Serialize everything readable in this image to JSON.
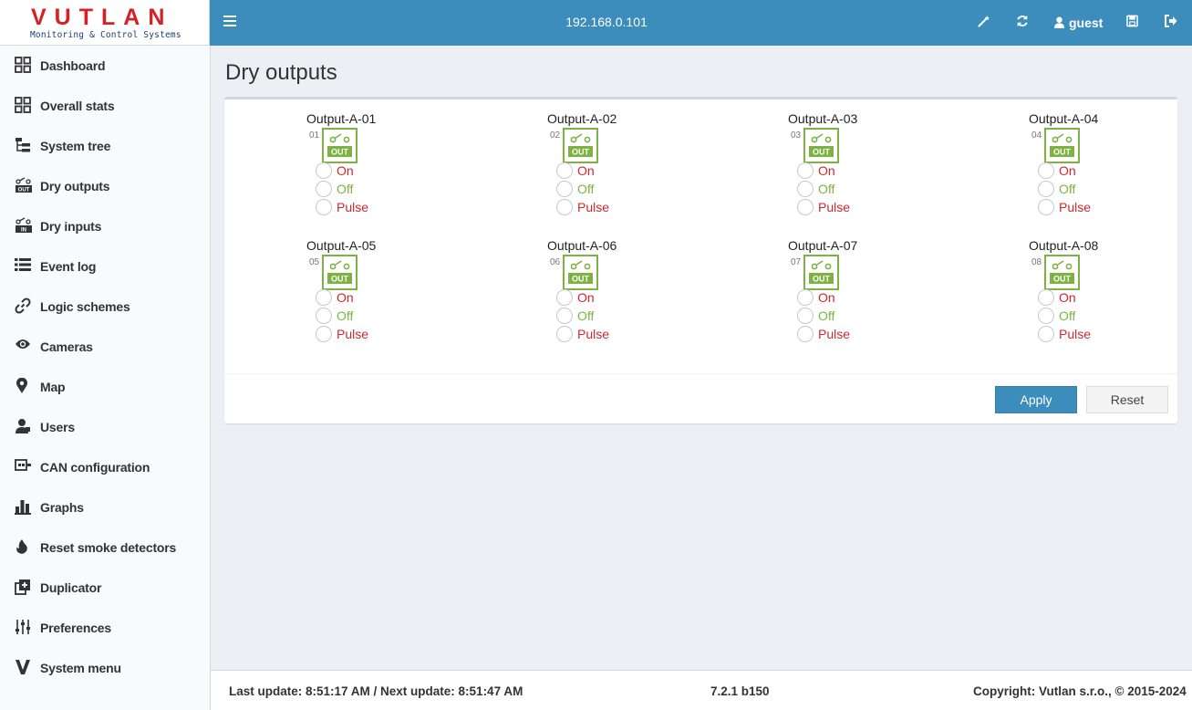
{
  "header": {
    "logo_main": "VUTLAN",
    "logo_sub": "Monitoring & Control Systems",
    "ip": "192.168.0.101",
    "user": "guest"
  },
  "sidebar": {
    "items": [
      {
        "label": "Dashboard",
        "icon": "grid-icon"
      },
      {
        "label": "Overall stats",
        "icon": "grid-icon"
      },
      {
        "label": "System tree",
        "icon": "tree-icon"
      },
      {
        "label": "Dry outputs",
        "icon": "out-icon"
      },
      {
        "label": "Dry inputs",
        "icon": "in-icon"
      },
      {
        "label": "Event log",
        "icon": "list-icon"
      },
      {
        "label": "Logic schemes",
        "icon": "link-icon"
      },
      {
        "label": "Cameras",
        "icon": "eye-icon"
      },
      {
        "label": "Map",
        "icon": "map-marker-icon"
      },
      {
        "label": "Users",
        "icon": "user-icon"
      },
      {
        "label": "CAN configuration",
        "icon": "can-icon"
      },
      {
        "label": "Graphs",
        "icon": "bar-chart-icon"
      },
      {
        "label": "Reset smoke detectors",
        "icon": "fire-icon"
      },
      {
        "label": "Duplicator",
        "icon": "duplicate-icon"
      },
      {
        "label": "Preferences",
        "icon": "sliders-icon"
      },
      {
        "label": "System menu",
        "icon": "v-logo-icon"
      }
    ]
  },
  "main": {
    "title": "Dry outputs",
    "outputs": [
      {
        "name": "Output-A-01",
        "num": "01"
      },
      {
        "name": "Output-A-02",
        "num": "02"
      },
      {
        "name": "Output-A-03",
        "num": "03"
      },
      {
        "name": "Output-A-04",
        "num": "04"
      },
      {
        "name": "Output-A-05",
        "num": "05"
      },
      {
        "name": "Output-A-06",
        "num": "06"
      },
      {
        "name": "Output-A-07",
        "num": "07"
      },
      {
        "name": "Output-A-08",
        "num": "08"
      }
    ],
    "options": {
      "on": "On",
      "off": "Off",
      "pulse": "Pulse"
    },
    "icon_text": "OUT",
    "apply_label": "Apply",
    "reset_label": "Reset"
  },
  "footer": {
    "update": "Last update: 8:51:17 AM / Next update: 8:51:47 AM",
    "version": "7.2.1 b150",
    "copyright": "Copyright: Vutlan s.r.o., © 2015-2024"
  },
  "colors": {
    "accent": "#3c8dbc",
    "brand_red": "#d71f25",
    "on": "#d0282e",
    "off": "#7cb342"
  }
}
